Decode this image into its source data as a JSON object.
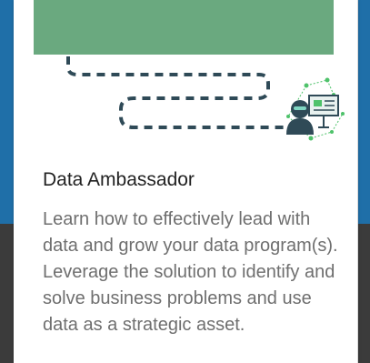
{
  "card": {
    "title": "Data Ambassador",
    "description": "Learn how to effectively lead with data and grow your data program(s). Leverage the solution to identify and solve business problems and use data as a strategic asset."
  },
  "colors": {
    "page_background_top": "#1f6fa8",
    "page_background_bottom": "#3b3b3b",
    "card_background": "#ffffff",
    "banner_green": "#6aa97f",
    "path_dash": "#2f4a57",
    "accent_green": "#4ec26a",
    "title_text": "#222222",
    "description_text": "#6f6f6f"
  },
  "icons": [
    "dashed-path",
    "presenter-avatar-icon",
    "presentation-board-icon",
    "network-dots"
  ]
}
